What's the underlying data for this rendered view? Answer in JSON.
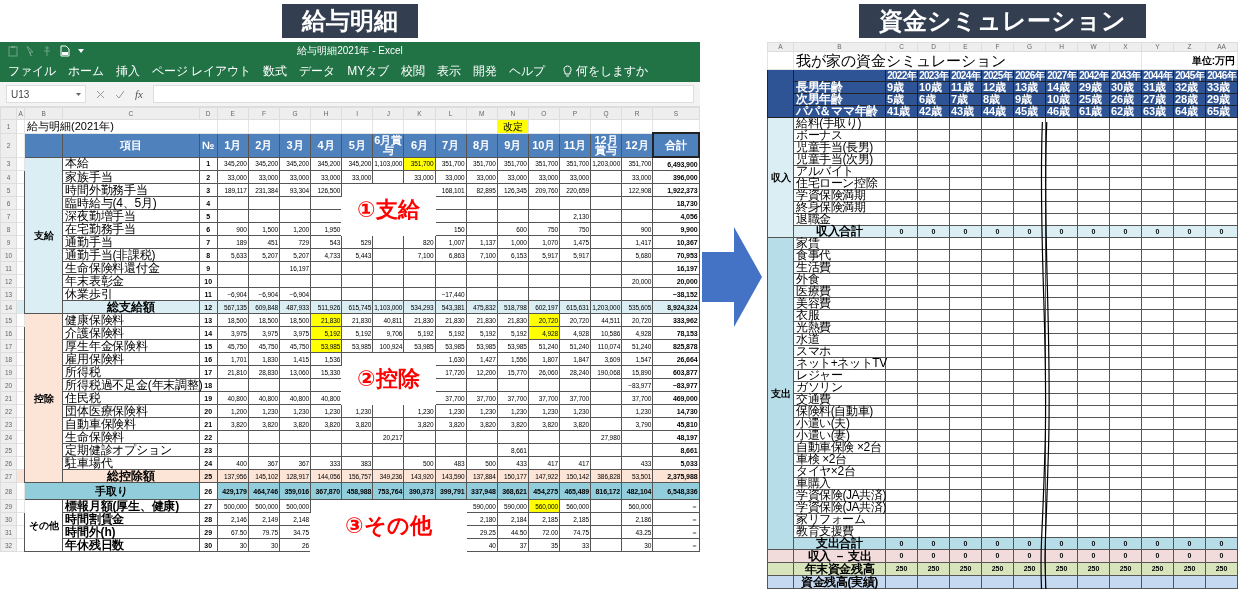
{
  "banners": [
    "給与明細",
    "資金シミュレーション"
  ],
  "salary": {
    "window_title": "給与明細2021年 - Excel",
    "menu": [
      "ファイル",
      "ホーム",
      "挿入",
      "ページ レイアウト",
      "数式",
      "データ",
      "MYタブ",
      "校閲",
      "表示",
      "開発",
      "ヘルプ"
    ],
    "search_hint": "何をしますか",
    "name_box": "U13",
    "function_label": "fx",
    "column_letters": [
      "A",
      "B",
      "C",
      "D",
      "E",
      "F",
      "G",
      "H",
      "I",
      "J",
      "K",
      "L",
      "M",
      "N",
      "O",
      "P",
      "Q",
      "R",
      "S"
    ],
    "title_row": {
      "row": "1",
      "title": "給与明細(2021年)",
      "note": "改定"
    },
    "header": {
      "row": "2",
      "item": "項目",
      "no": "№",
      "months": [
        "1月",
        "2月",
        "3月",
        "4月",
        "5月",
        "6月賞与",
        "6月",
        "7月",
        "8月",
        "9月",
        "10月",
        "11月",
        "12月賞与",
        "12月"
      ],
      "total": "合計"
    },
    "groups": [
      {
        "kind": "income",
        "label": "支給",
        "rows": [
          {
            "row": "3",
            "kind": "item",
            "item": "本給",
            "no": "1",
            "cells": {
              "E": "345,200",
              "F": "345,200",
              "G": "345,200",
              "H": "345,200",
              "I": "345,200",
              "J": "1,103,000",
              "K": "351,700",
              "L": "351,700",
              "M": "351,700",
              "N": "351,700",
              "O": "351,700",
              "P": "351,700",
              "Q": "1,203,000",
              "R": "351,700",
              "S": "6,493,900"
            },
            "highlighted": {
              "K": true
            }
          },
          {
            "row": "4",
            "kind": "item",
            "item": "家族手当",
            "no": "2",
            "cells": {
              "E": "33,000",
              "F": "33,000",
              "G": "33,000",
              "H": "33,000",
              "I": "33,000",
              "K": "33,000",
              "L": "33,000",
              "M": "33,000",
              "N": "33,000",
              "O": "33,000",
              "P": "33,000",
              "R": "33,000",
              "S": "396,000"
            }
          },
          {
            "row": "5",
            "kind": "item",
            "item": "時間外勤務手当",
            "no": "3",
            "cells": {
              "E": "189,117",
              "F": "231,384",
              "G": "93,304",
              "H": "126,500",
              "L": "168,101",
              "M": "82,895",
              "N": "126,345",
              "O": "209,760",
              "P": "220,659",
              "R": "122,908",
              "S": "1,922,373"
            }
          },
          {
            "row": "6",
            "kind": "item",
            "item": "臨時給与(4、5月)",
            "no": "4",
            "cells": {
              "S": "18,730"
            }
          },
          {
            "row": "7",
            "kind": "item",
            "item": "深夜勤増手当",
            "no": "5",
            "cells": {
              "P": "2,130",
              "S": "4,056"
            }
          },
          {
            "row": "8",
            "kind": "item",
            "item": "在宅勤務手当",
            "no": "6",
            "cells": {
              "E": "900",
              "F": "1,500",
              "G": "1,200",
              "H": "1,950",
              "L": "150",
              "N": "600",
              "O": "750",
              "P": "750",
              "R": "900",
              "S": "9,900"
            }
          },
          {
            "row": "9",
            "kind": "item",
            "item": "通勤手当",
            "no": "7",
            "cells": {
              "E": "189",
              "F": "451",
              "G": "729",
              "H": "543",
              "I": "529",
              "K": "820",
              "L": "1,007",
              "M": "1,137",
              "N": "1,000",
              "O": "1,070",
              "P": "1,475",
              "R": "1,417",
              "S": "10,367"
            }
          },
          {
            "row": "10",
            "kind": "item",
            "item": "通勤手当(非課税)",
            "no": "8",
            "cells": {
              "E": "5,633",
              "F": "5,207",
              "G": "5,207",
              "H": "4,733",
              "I": "5,443",
              "K": "7,100",
              "L": "6,863",
              "M": "7,100",
              "N": "6,153",
              "O": "5,917",
              "P": "5,917",
              "R": "5,680",
              "S": "70,953"
            }
          },
          {
            "row": "11",
            "kind": "item",
            "item": "生命保険料還付金",
            "no": "9",
            "cells": {
              "G": "16,197",
              "S": "16,197"
            }
          },
          {
            "row": "12",
            "kind": "item",
            "item": "年末表彰金",
            "no": "10",
            "cells": {
              "R": "20,000",
              "S": "20,000"
            }
          },
          {
            "row": "13",
            "kind": "item",
            "item": "休業歩引",
            "no": "11",
            "cells": {
              "E": "−6,904",
              "F": "−6,904",
              "G": "−6,904",
              "L": "−17,440",
              "S": "−38,152"
            }
          },
          {
            "row": "14",
            "kind": "total",
            "item": "総支給額",
            "no": "12",
            "cells": {
              "E": "567,135",
              "F": "609,848",
              "G": "487,933",
              "H": "511,926",
              "I": "615,745",
              "J": "1,103,000",
              "K": "534,293",
              "L": "543,381",
              "M": "475,832",
              "N": "518,798",
              "O": "602,197",
              "P": "615,631",
              "Q": "1,203,000",
              "R": "535,605",
              "S": "8,924,324"
            }
          }
        ]
      },
      {
        "kind": "deduction",
        "label": "控除",
        "rows": [
          {
            "row": "15",
            "kind": "item",
            "item": "健康保険料",
            "no": "13",
            "cells": {
              "E": "18,500",
              "F": "18,500",
              "G": "18,500",
              "H": "21,830",
              "I": "21,830",
              "J": "40,811",
              "K": "21,830",
              "L": "21,830",
              "M": "21,830",
              "N": "21,830",
              "O": "20,720",
              "P": "20,720",
              "Q": "44,511",
              "R": "20,720",
              "S": "333,962"
            },
            "highlighted": {
              "H": true,
              "O": true
            }
          },
          {
            "row": "16",
            "kind": "item",
            "item": "介護保険料",
            "no": "14",
            "cells": {
              "E": "3,975",
              "F": "3,975",
              "G": "3,975",
              "H": "5,192",
              "I": "5,192",
              "J": "9,706",
              "K": "5,192",
              "L": "5,192",
              "M": "5,192",
              "N": "5,192",
              "O": "4,928",
              "P": "4,928",
              "Q": "10,586",
              "R": "4,928",
              "S": "78,153"
            },
            "highlighted": {
              "H": true,
              "O": true
            }
          },
          {
            "row": "17",
            "kind": "item",
            "item": "厚生年金保険料",
            "no": "15",
            "cells": {
              "E": "45,750",
              "F": "45,750",
              "G": "45,750",
              "H": "53,985",
              "I": "53,985",
              "J": "100,924",
              "K": "53,985",
              "L": "53,985",
              "M": "53,985",
              "N": "53,985",
              "O": "51,240",
              "P": "51,240",
              "Q": "110,074",
              "R": "51,240",
              "S": "825,878"
            },
            "highlighted": {
              "H": true
            }
          },
          {
            "row": "18",
            "kind": "item",
            "item": "雇用保険料",
            "no": "16",
            "cells": {
              "E": "1,701",
              "F": "1,830",
              "G": "1,415",
              "H": "1,536",
              "L": "1,630",
              "M": "1,427",
              "N": "1,556",
              "O": "1,807",
              "P": "1,847",
              "Q": "3,609",
              "R": "1,547",
              "S": "26,664"
            }
          },
          {
            "row": "19",
            "kind": "item",
            "item": "所得税",
            "no": "17",
            "cells": {
              "E": "21,810",
              "F": "28,830",
              "G": "13,060",
              "H": "15,330",
              "L": "17,720",
              "M": "12,200",
              "N": "15,770",
              "O": "26,060",
              "P": "28,240",
              "Q": "190,068",
              "R": "15,890",
              "S": "603,877"
            }
          },
          {
            "row": "20",
            "kind": "item",
            "item": "所得税過不足金(年末調整)",
            "no": "18",
            "cells": {
              "R": "−83,977",
              "S": "−83,977"
            }
          },
          {
            "row": "21",
            "kind": "item",
            "item": "住民税",
            "no": "19",
            "cells": {
              "E": "40,800",
              "F": "40,800",
              "G": "40,800",
              "H": "40,800",
              "L": "37,700",
              "M": "37,700",
              "N": "37,700",
              "O": "37,700",
              "P": "37,700",
              "R": "37,700",
              "S": "469,000"
            }
          },
          {
            "row": "22",
            "kind": "item",
            "item": "団体医療保険料",
            "no": "20",
            "cells": {
              "E": "1,200",
              "F": "1,230",
              "G": "1,230",
              "H": "1,230",
              "I": "1,230",
              "K": "1,230",
              "L": "1,230",
              "M": "1,230",
              "N": "1,230",
              "O": "1,230",
              "P": "1,230",
              "R": "1,230",
              "S": "14,730"
            }
          },
          {
            "row": "23",
            "kind": "item",
            "item": "自動車保険料",
            "no": "21",
            "cells": {
              "E": "3,820",
              "F": "3,820",
              "G": "3,820",
              "H": "3,820",
              "I": "3,820",
              "K": "3,820",
              "L": "3,820",
              "M": "3,820",
              "N": "3,820",
              "O": "3,820",
              "P": "3,820",
              "R": "3,790",
              "S": "45,810"
            }
          },
          {
            "row": "24",
            "kind": "item",
            "item": "生命保険料",
            "no": "22",
            "cells": {
              "J": "20,217",
              "Q": "27,980",
              "S": "48,197"
            }
          },
          {
            "row": "25",
            "kind": "item",
            "item": "定期健診オプション",
            "no": "23",
            "cells": {
              "N": "8,661",
              "S": "8,661"
            }
          },
          {
            "row": "26",
            "kind": "item",
            "item": "駐車場代",
            "no": "24",
            "cells": {
              "E": "400",
              "F": "367",
              "G": "367",
              "H": "333",
              "I": "383",
              "K": "500",
              "L": "483",
              "M": "500",
              "N": "433",
              "O": "417",
              "P": "417",
              "R": "433",
              "S": "5,033"
            }
          },
          {
            "row": "27",
            "kind": "total",
            "item": "総控除額",
            "no": "25",
            "cells": {
              "E": "137,956",
              "F": "145,102",
              "G": "128,917",
              "H": "144,056",
              "I": "156,757",
              "J": "349,236",
              "K": "143,920",
              "L": "143,590",
              "M": "137,884",
              "N": "150,177",
              "O": "147,922",
              "P": "150,142",
              "Q": "386,828",
              "R": "53,501",
              "S": "2,375,988"
            }
          }
        ]
      },
      {
        "kind": "net",
        "label": "手取り",
        "rows": [
          {
            "row": "28",
            "kind": "net",
            "no": "26",
            "cells": {
              "E": "429,179",
              "F": "464,746",
              "G": "359,016",
              "H": "367,870",
              "I": "458,988",
              "J": "753,764",
              "K": "390,373",
              "L": "399,791",
              "M": "337,948",
              "N": "368,621",
              "O": "454,275",
              "P": "465,489",
              "Q": "816,172",
              "R": "482,104",
              "S": "6,548,336"
            }
          }
        ]
      },
      {
        "kind": "other",
        "label": "その他",
        "rows": [
          {
            "row": "29",
            "kind": "item",
            "item": "標報月額(厚生、健康)",
            "no": "27",
            "cells": {
              "E": "500,000",
              "F": "500,000",
              "G": "500,000",
              "M": "590,000",
              "N": "590,000",
              "O": "560,000",
              "P": "560,000",
              "R": "560,000",
              "S": "－"
            },
            "highlighted": {
              "O": true
            }
          },
          {
            "row": "30",
            "kind": "item",
            "item": "時間割賃金",
            "no": "28",
            "cells": {
              "E": "2,146",
              "F": "2,149",
              "G": "2,148",
              "M": "2,180",
              "N": "2,184",
              "O": "2,185",
              "P": "2,185",
              "R": "2,186",
              "S": "－"
            }
          },
          {
            "row": "31",
            "kind": "item",
            "item": "時間外(h)",
            "no": "29",
            "cells": {
              "E": "67.50",
              "F": "79.75",
              "G": "34.75",
              "M": "29.25",
              "N": "44.50",
              "O": "72.00",
              "P": "74.75",
              "R": "43.25",
              "S": "－"
            }
          },
          {
            "row": "32",
            "kind": "item",
            "item": "年休残日数",
            "no": "30",
            "cells": {
              "E": "30",
              "F": "30",
              "G": "26",
              "M": "40",
              "N": "37",
              "O": "35",
              "P": "33",
              "R": "30",
              "S": "－"
            }
          }
        ]
      }
    ],
    "callouts": [
      "①支給",
      "②控除",
      "③その他"
    ]
  },
  "simulation": {
    "column_letters": [
      "A",
      "B",
      "C",
      "D",
      "E",
      "F",
      "G",
      "H",
      "W",
      "X",
      "Y",
      "Z",
      "AA"
    ],
    "title": "我が家の資金シミュレーション",
    "unit": "単位:万円",
    "years": [
      "2022年",
      "2023年",
      "2024年",
      "2025年",
      "2026年",
      "2027年",
      "2042年",
      "2043年",
      "2044年",
      "2045年",
      "2046年"
    ],
    "age_rows": [
      {
        "label": "長男年齢",
        "values": [
          "9歳",
          "10歳",
          "11歳",
          "12歳",
          "13歳",
          "14歳",
          "29歳",
          "30歳",
          "31歳",
          "32歳",
          "33歳"
        ]
      },
      {
        "label": "次男年齢",
        "values": [
          "5歳",
          "6歳",
          "7歳",
          "8歳",
          "9歳",
          "10歳",
          "25歳",
          "26歳",
          "27歳",
          "28歳",
          "29歳"
        ]
      },
      {
        "label": "パパ＆ママ年齢",
        "values": [
          "41歳",
          "42歳",
          "43歳",
          "44歳",
          "45歳",
          "46歳",
          "61歳",
          "62歳",
          "63歳",
          "64歳",
          "65歳"
        ]
      }
    ],
    "groups": [
      {
        "kind": "income",
        "label": "収入",
        "items": [
          "給料(手取り)",
          "ボーナス",
          "児童手当(長男)",
          "児童手当(次男)",
          "アルバイト",
          "住宅ローン控除",
          "学資保険満期",
          "終身保険満期",
          "退職金"
        ],
        "total": {
          "label": "収入合計",
          "values": [
            "0",
            "0",
            "0",
            "0",
            "0",
            "0",
            "0",
            "0",
            "0",
            "0",
            "0"
          ]
        }
      },
      {
        "kind": "expense",
        "label": "支出",
        "items": [
          "家賃",
          "食事代",
          "生活費",
          "外食",
          "医療費",
          "美容費",
          "衣服",
          "光熱費",
          "水道",
          "スマホ",
          "ネット+ネットTV",
          "レジャー",
          "ガソリン",
          "交通費",
          "保険料(自動車)",
          "小遣い(夫)",
          "小遣い(妻)",
          "自動車保険 ×2台",
          "車検 ×2台",
          "タイヤ×2台",
          "車購入",
          "学資保険(JA共済)",
          "学資保険(JA共済)",
          "家リフォーム",
          "教育支援費"
        ],
        "total": {
          "label": "支出合計",
          "values": [
            "0",
            "0",
            "0",
            "0",
            "0",
            "0",
            "0",
            "0",
            "0",
            "0",
            "0"
          ]
        }
      }
    ],
    "summary_rows": [
      {
        "kind": "difference",
        "label": "収入 － 支出",
        "values": [
          "0",
          "0",
          "0",
          "0",
          "0",
          "0",
          "0",
          "0",
          "0",
          "0",
          "0"
        ]
      },
      {
        "kind": "balance",
        "label": "年末資金残高",
        "values": [
          "250",
          "250",
          "250",
          "250",
          "250",
          "250",
          "250",
          "250",
          "250",
          "250",
          "250"
        ]
      },
      {
        "kind": "actual",
        "label": "資金残高(実績)"
      }
    ]
  }
}
